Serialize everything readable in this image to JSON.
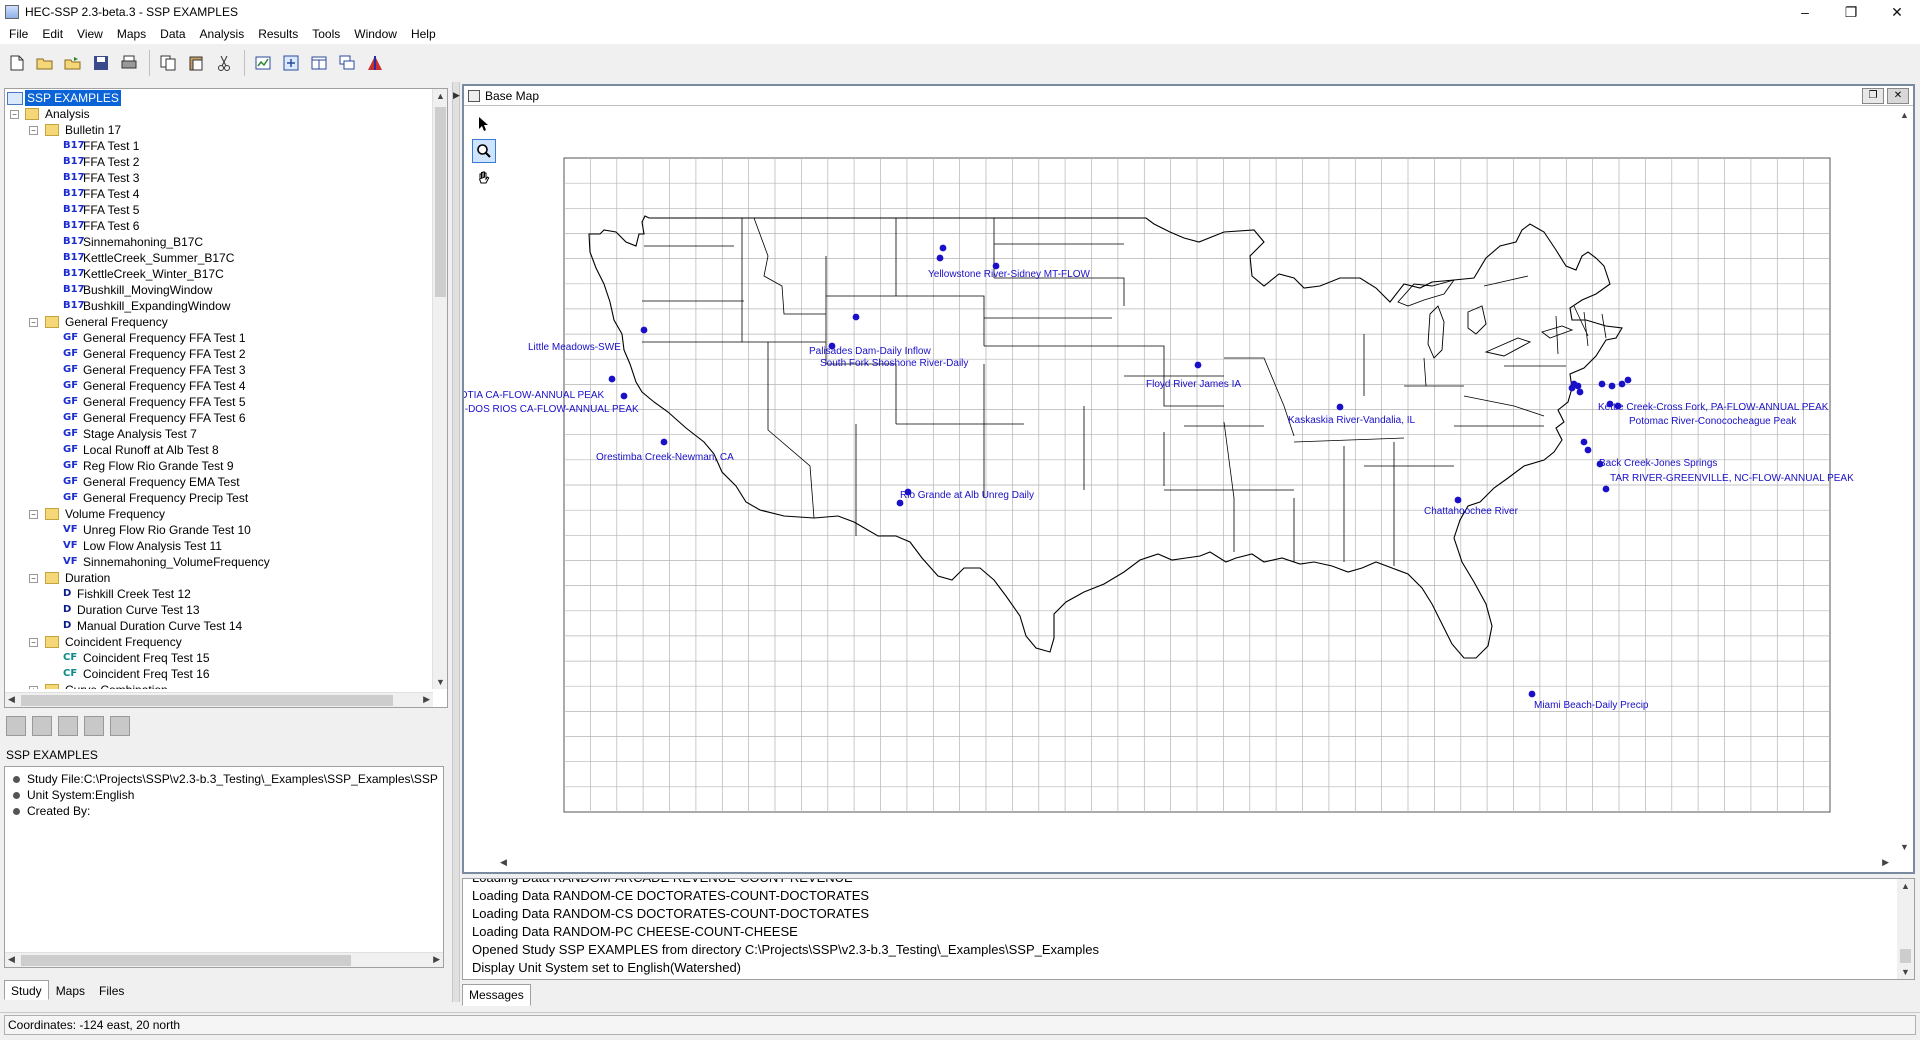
{
  "window": {
    "title": "HEC-SSP 2.3-beta.3 - SSP EXAMPLES",
    "minimize": "–",
    "maximize": "❐",
    "close": "✕"
  },
  "menu": [
    "File",
    "Edit",
    "View",
    "Maps",
    "Data",
    "Analysis",
    "Results",
    "Tools",
    "Window",
    "Help"
  ],
  "tree": {
    "root": "SSP EXAMPLES",
    "analysis_folder": "Analysis",
    "groups": [
      {
        "label": "Bulletin 17",
        "tag": "B17",
        "items": [
          "FFA Test 1",
          "FFA Test 2",
          "FFA Test 3",
          "FFA Test 4",
          "FFA Test 5",
          "FFA Test 6",
          "Sinnemahoning_B17C",
          "KettleCreek_Summer_B17C",
          "KettleCreek_Winter_B17C",
          "Bushkill_MovingWindow",
          "Bushkill_ExpandingWindow"
        ]
      },
      {
        "label": "General Frequency",
        "tag": "GF",
        "items": [
          "General Frequency FFA Test 1",
          "General Frequency FFA Test 2",
          "General Frequency FFA Test 3",
          "General Frequency FFA Test 4",
          "General Frequency FFA Test 5",
          "General Frequency FFA Test 6",
          "Stage Analysis Test 7",
          "Local Runoff at Alb Test 8",
          "Reg Flow Rio Grande Test 9",
          "General Frequency EMA Test",
          "General Frequency Precip Test"
        ]
      },
      {
        "label": "Volume Frequency",
        "tag": "VF",
        "items": [
          "Unreg Flow Rio Grande Test 10",
          "Low Flow Analysis Test 11",
          "Sinnemahoning_VolumeFrequency"
        ]
      },
      {
        "label": "Duration",
        "tag": "D",
        "items": [
          "Fishkill Creek Test 12",
          "Duration Curve Test 13",
          "Manual Duration Curve Test 14"
        ]
      },
      {
        "label": "Coincident Frequency",
        "tag": "CF",
        "items": [
          "Coincident Freq Test 15",
          "Coincident Freq Test 16"
        ]
      },
      {
        "label": "Curve Combination",
        "tag": "",
        "items": []
      }
    ]
  },
  "info": {
    "title": "SSP EXAMPLES",
    "rows": [
      "Study File:C:\\Projects\\SSP\\v2.3-b.3_Testing\\_Examples\\SSP_Examples\\SSP",
      "Unit System:English",
      "Created By:"
    ]
  },
  "left_tabs": [
    "Study",
    "Maps",
    "Files"
  ],
  "map": {
    "title": "Base Map",
    "gauges": [
      {
        "label": "Little Meadows-SWE"
      },
      {
        "label": "EEL R-SCOTIA CA-FLOW-ANNUAL PEAK"
      },
      {
        "label": "MF EEL R-DOS RIOS CA-FLOW-ANNUAL PEAK"
      },
      {
        "label": "Orestimba Creek-Newman, CA"
      },
      {
        "label": "Yellowstone River-Sidney MT-FLOW"
      },
      {
        "label": "South Fork Shoshone River-Daily"
      },
      {
        "label": "Palisades Dam-Daily Inflow"
      },
      {
        "label": "Rio Grande at Alb Unreg Daily"
      },
      {
        "label": "Floyd River James IA"
      },
      {
        "label": "Kaskaskia River-Vandalia, IL"
      },
      {
        "label": "Kettle Creek-Cross Fork, PA-FLOW-ANNUAL PEAK"
      },
      {
        "label": "Potomac River-Conococheague Peak"
      },
      {
        "label": "Back Creek-Jones Springs"
      },
      {
        "label": "TAR RIVER-GREENVILLE, NC-FLOW-ANNUAL PEAK"
      },
      {
        "label": "Chattahoochee River"
      },
      {
        "label": "Miami Beach-Daily Precip"
      }
    ]
  },
  "messages": {
    "lines": [
      "Loading Data RANDOM-ARCADE REVENUE-COUNT-REVENUE",
      "Loading Data RANDOM-CE DOCTORATES-COUNT-DOCTORATES",
      "Loading Data RANDOM-CS DOCTORATES-COUNT-DOCTORATES",
      "Loading Data RANDOM-PC CHEESE-COUNT-CHEESE",
      "Opened Study SSP EXAMPLES from directory C:\\Projects\\SSP\\v2.3-b.3_Testing\\_Examples\\SSP_Examples",
      "Display Unit System set to English(Watershed)"
    ],
    "tab": "Messages"
  },
  "status": {
    "coordinates": "Coordinates: -124 east, 20 north"
  },
  "colors": {
    "gauge": "#1a10c8",
    "gauge_label": "#1a10c8",
    "selection": "#0a64d8"
  }
}
